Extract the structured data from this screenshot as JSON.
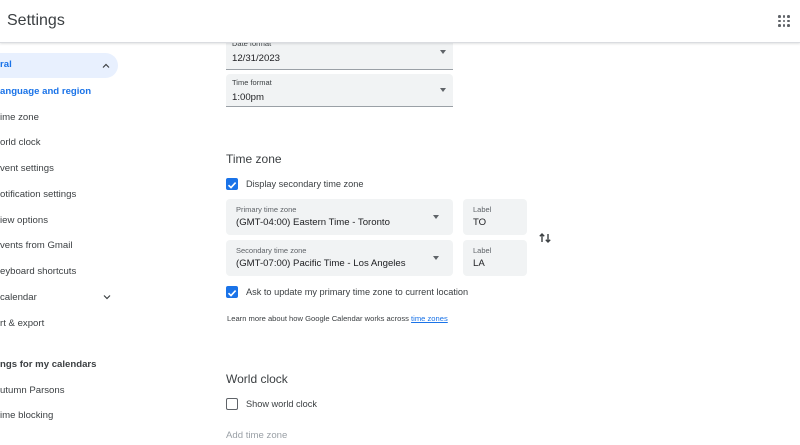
{
  "header": {
    "title": "Settings",
    "apps_icon": "apps-grid-icon"
  },
  "sidebar": {
    "general_label": "ral",
    "items": [
      {
        "label": "anguage and region",
        "active": true
      },
      {
        "label": "ime zone"
      },
      {
        "label": "orld clock"
      },
      {
        "label": "vent settings"
      },
      {
        "label": "otification settings"
      },
      {
        "label": "iew options"
      },
      {
        "label": "vents from Gmail"
      },
      {
        "label": "eyboard shortcuts"
      },
      {
        "label": "calendar"
      },
      {
        "label": "rt & export"
      }
    ],
    "my_calendars_heading": "ngs for my calendars",
    "calendars": [
      {
        "label": "utumn Parsons"
      },
      {
        "label": "ime blocking"
      }
    ]
  },
  "date_format": {
    "label": "Date format",
    "value": "12/31/2023"
  },
  "time_format": {
    "label": "Time format",
    "value": "1:00pm"
  },
  "time_zone": {
    "title": "Time zone",
    "display_secondary_label": "Display secondary time zone",
    "display_secondary_checked": true,
    "primary": {
      "label": "Primary time zone",
      "value": "(GMT-04:00) Eastern Time - Toronto",
      "tag_label": "Label",
      "tag_value": "TO"
    },
    "secondary": {
      "label": "Secondary time zone",
      "value": "(GMT-07:00) Pacific Time - Los Angeles",
      "tag_label": "Label",
      "tag_value": "LA"
    },
    "ask_update_label": "Ask to update my primary time zone to current location",
    "ask_update_checked": true,
    "info_text": "Learn more about how Google Calendar works across ",
    "info_link": "time zones"
  },
  "world_clock": {
    "title": "World clock",
    "show_label": "Show world clock",
    "show_checked": false,
    "add_label": "Add time zone"
  },
  "colors": {
    "accent": "#1a73e8",
    "active_bg": "#e8f0fe",
    "field_bg": "#f1f3f4"
  }
}
